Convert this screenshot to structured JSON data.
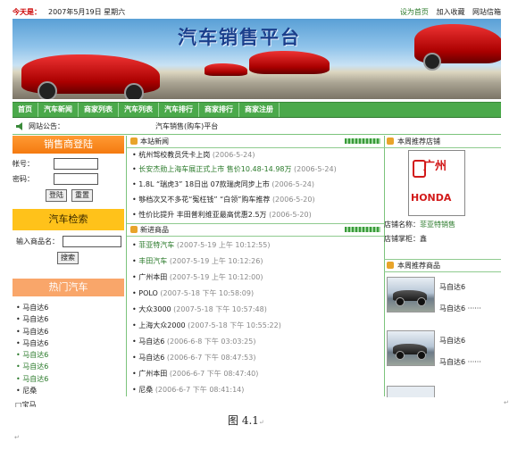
{
  "topbar": {
    "today_label": "今天是：",
    "date": "2007年5月19日  星期六",
    "set_home": "设为首页",
    "add_fav": "加入收藏",
    "contact": "网站信箱"
  },
  "banner": {
    "title": "汽车销售平台"
  },
  "nav": [
    "首页",
    "汽车新闻",
    "商家列表",
    "汽车列表",
    "汽车排行",
    "商家排行",
    "商家注册"
  ],
  "notice": {
    "label": "网站公告：",
    "text": "汽车销售(购车)平台"
  },
  "login": {
    "title": "销售商登陆",
    "account_label": "帐号：",
    "password_label": "密码：",
    "login_btn": "登陆",
    "reset_btn": "重置"
  },
  "search": {
    "title": "汽车检索",
    "name_label": "输入商品名：",
    "search_btn": "搜索"
  },
  "hot": {
    "title": "热门汽车",
    "items": [
      "马自达6",
      "马自达6",
      "马自达6",
      "马自达6",
      "马自达6",
      "马自达6",
      "马自达6",
      "尼桑"
    ],
    "cut_item": "宝马"
  },
  "news": {
    "title": "本站新闻",
    "items": [
      {
        "text": "杭州驾校教员凭卡上岗",
        "date": "(2006-5-24)"
      },
      {
        "text": "长安杰勋上海车展正式上市 售价10.48-14.98万",
        "date": "(2006-5-24)"
      },
      {
        "text": "1.8L “瑞虎3” 18日出 07款瑞虎同步上市",
        "date": "(2006-5-24)"
      },
      {
        "text": "够档次又不多花“冤枉钱” “白领”购车推荐",
        "date": "(2006-5-20)"
      },
      {
        "text": "性价比提升 丰田普利维亚最高优惠2.5万",
        "date": "(2006-5-20)"
      }
    ]
  },
  "products": {
    "title": "新进商品",
    "items": [
      {
        "text": "菲亚特汽车",
        "date": "(2007-5-19 上午 10:12:55)",
        "green": true
      },
      {
        "text": "丰田汽车",
        "date": "(2007-5-19 上午 10:12:26)",
        "green": true
      },
      {
        "text": "广州本田",
        "date": "(2007-5-19 上午 10:12:00)",
        "green": false
      },
      {
        "text": "POLO",
        "date": "(2007-5-18 下午 10:58:09)",
        "green": false
      },
      {
        "text": "大众3000",
        "date": "(2007-5-18 下午 10:57:48)",
        "green": false
      },
      {
        "text": "上海大众2000",
        "date": "(2007-5-18 下午 10:55:22)",
        "green": false
      },
      {
        "text": "马自达6",
        "date": "(2006-6-8 下午 03:03:25)",
        "green": false
      },
      {
        "text": "马自达6",
        "date": "(2006-6-7 下午 08:47:53)",
        "green": false
      },
      {
        "text": "广州本田",
        "date": "(2006-6-7 下午 08:47:40)",
        "green": false
      },
      {
        "text": "尼桑",
        "date": "(2006-6-7 下午 08:41:14)",
        "green": false
      }
    ]
  },
  "shop": {
    "title": "本周推荐店铺",
    "logo_cn": "广州",
    "logo_en": "HONDA",
    "name_label": "店铺名称：",
    "name_value": "菲亚特销售",
    "owner_label": "店铺掌柜：",
    "owner_value": "鑫"
  },
  "recommend": {
    "title": "本周推荐商品",
    "items": [
      {
        "name": "马自达6",
        "extra": "马自达6 ······"
      },
      {
        "name": "马自达6",
        "extra": "马自达6 ······"
      }
    ]
  },
  "caption": "图 4.1"
}
